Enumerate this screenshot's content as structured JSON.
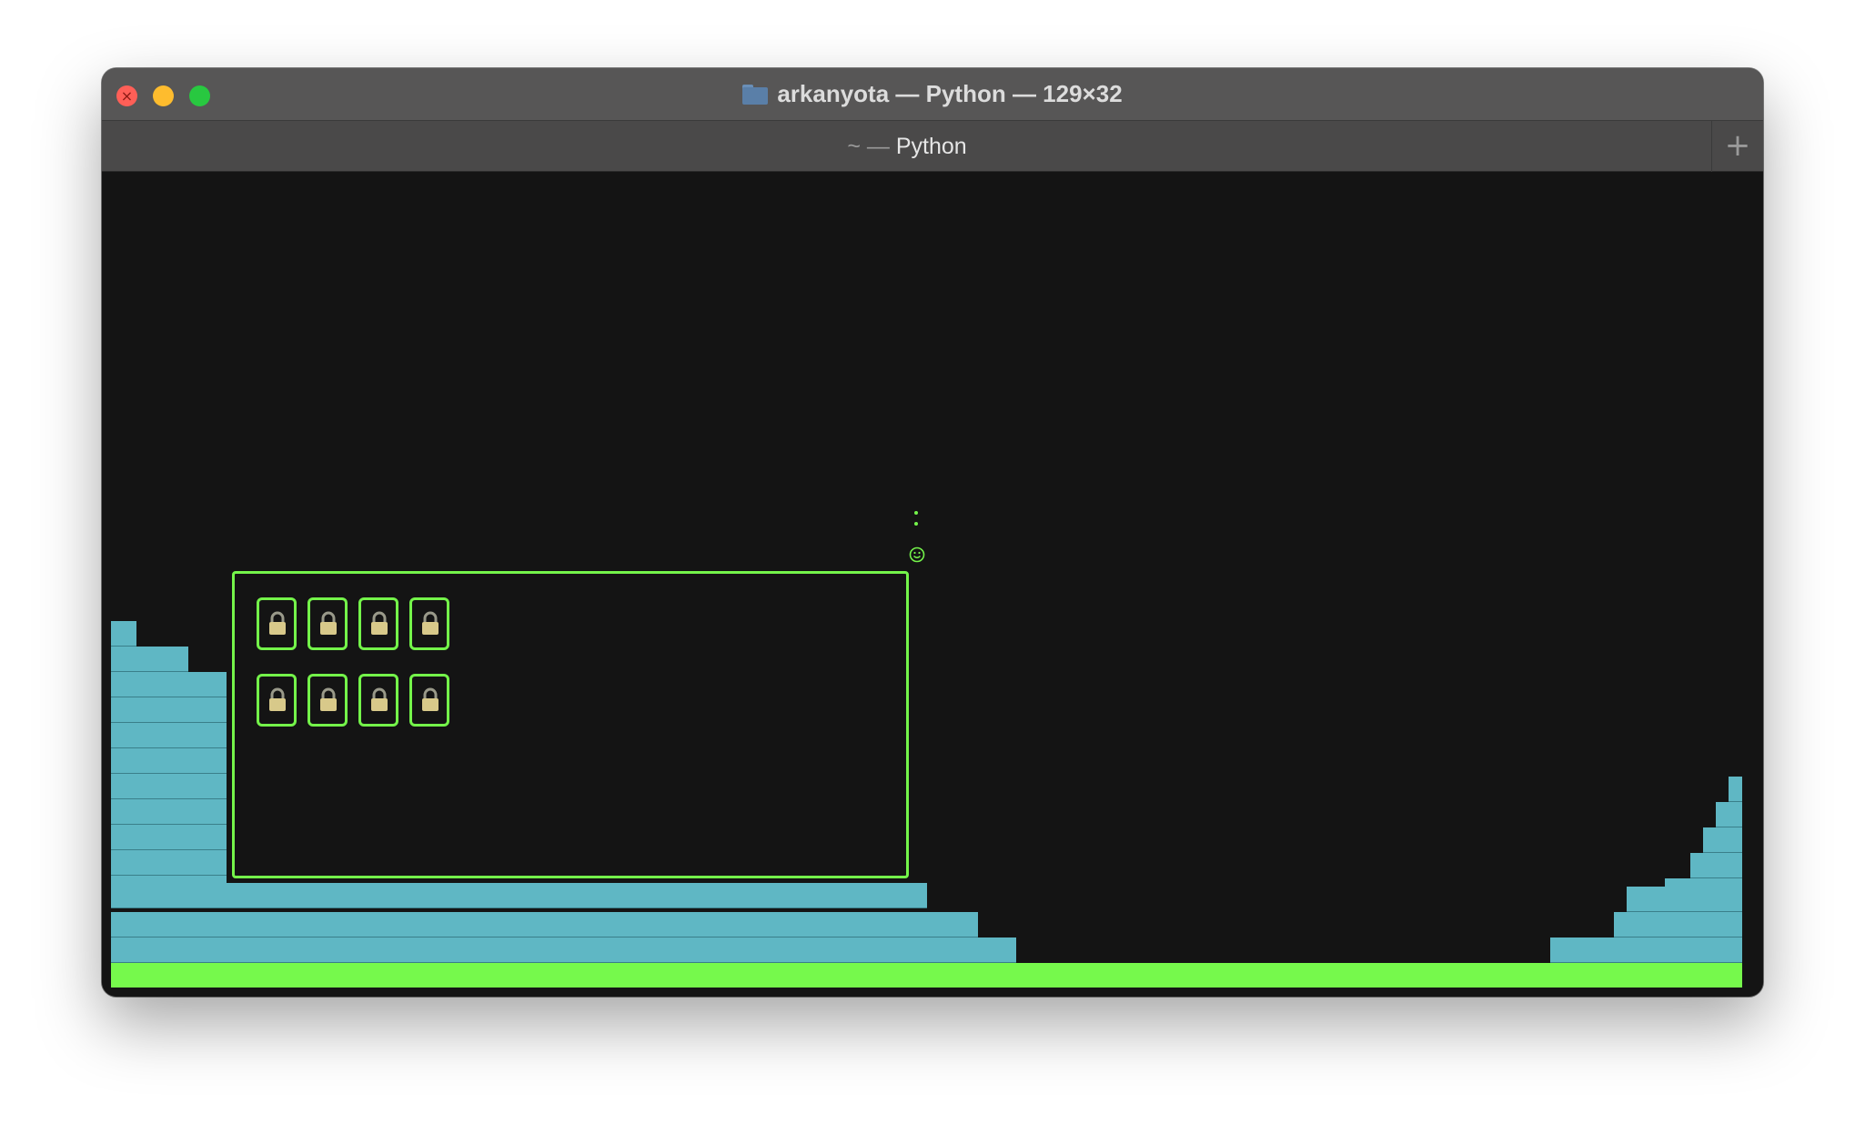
{
  "window": {
    "title": "arkanyota — Python — 129×32",
    "tab": {
      "prefix": "~ —",
      "label": "Python"
    },
    "new_tab_label": "+"
  },
  "colors": {
    "wall": "#5fb7c4",
    "ground": "#76f94c",
    "frame": "#74f44a",
    "background": "#141414"
  },
  "game": {
    "player_icon": "smiley-face-icon",
    "lock_icon": "lock-icon",
    "lock_rows": 2,
    "locks_per_row": 4
  }
}
